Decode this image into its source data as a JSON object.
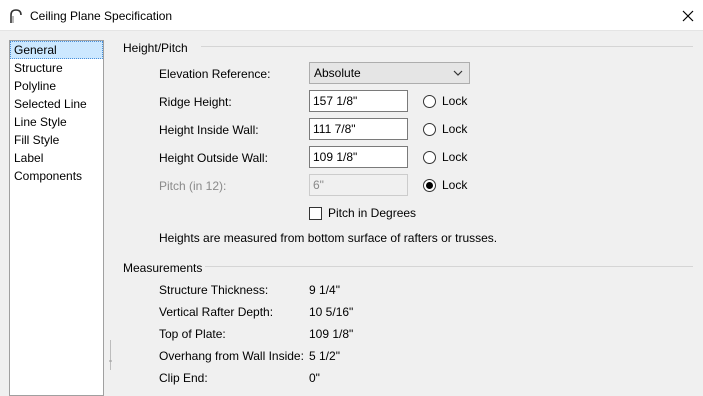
{
  "window": {
    "title": "Ceiling Plane Specification",
    "close_icon": "close-icon",
    "app_icon": "ceiling-plane-icon"
  },
  "sidebar": {
    "items": [
      {
        "label": "General",
        "selected": true
      },
      {
        "label": "Structure"
      },
      {
        "label": "Polyline"
      },
      {
        "label": "Selected Line"
      },
      {
        "label": "Line Style"
      },
      {
        "label": "Fill Style"
      },
      {
        "label": "Label"
      },
      {
        "label": "Components"
      }
    ]
  },
  "height_pitch": {
    "group_title": "Height/Pitch",
    "elevation_reference": {
      "label": "Elevation Reference:",
      "value": "Absolute"
    },
    "ridge_height": {
      "label": "Ridge Height:",
      "value": "157 1/8\"",
      "lock_label": "Lock",
      "locked": false
    },
    "height_inside_wall": {
      "label": "Height Inside Wall:",
      "value": "111 7/8\"",
      "lock_label": "Lock",
      "locked": false
    },
    "height_outside_wall": {
      "label": "Height Outside Wall:",
      "value": "109 1/8\"",
      "lock_label": "Lock",
      "locked": false
    },
    "pitch": {
      "label": "Pitch (in 12):",
      "value": "6\"",
      "lock_label": "Lock",
      "locked": true
    },
    "pitch_in_degrees": {
      "label": "Pitch in Degrees",
      "checked": false
    },
    "note": "Heights are measured from bottom surface of rafters or trusses."
  },
  "measurements": {
    "group_title": "Measurements",
    "rows": [
      {
        "label": "Structure Thickness:",
        "value": "9 1/4\""
      },
      {
        "label": "Vertical Rafter Depth:",
        "value": "10 5/16\""
      },
      {
        "label": "Top of Plate:",
        "value": "109 1/8\""
      },
      {
        "label": "Overhang from Wall Inside:",
        "value": "5 1/2\""
      },
      {
        "label": "Clip End:",
        "value": "0\""
      }
    ]
  }
}
